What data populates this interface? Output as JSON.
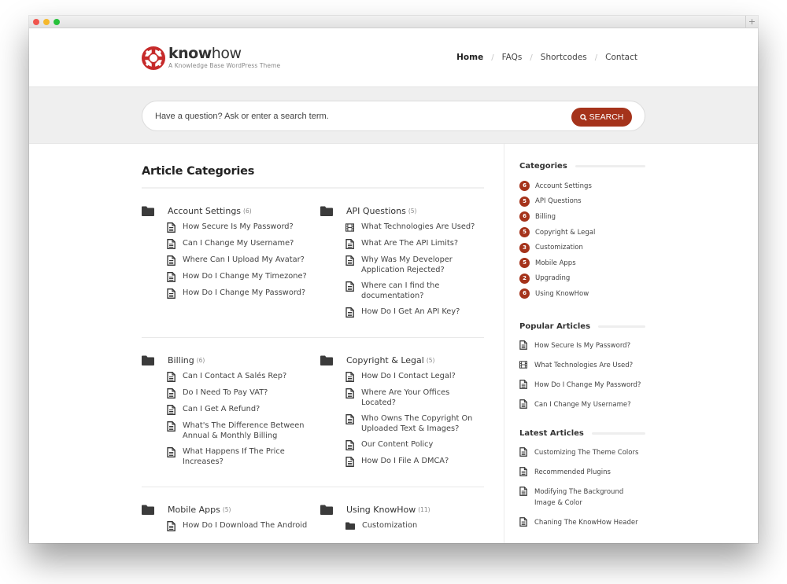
{
  "window": {
    "controls": [
      "close",
      "minimize",
      "maximize"
    ],
    "new_tab_icon": "plus-icon",
    "new_tab_label": "+"
  },
  "header": {
    "logo": {
      "icon": "lifebuoy-icon",
      "word_bold": "know",
      "word_light": "how",
      "tagline": "A Knowledge Base WordPress Theme"
    },
    "nav": [
      {
        "label": "Home",
        "active": true
      },
      {
        "label": "FAQs",
        "active": false
      },
      {
        "label": "Shortcodes",
        "active": false
      },
      {
        "label": "Contact",
        "active": false
      }
    ],
    "nav_separator": "/"
  },
  "search": {
    "placeholder": "Have a question? Ask or enter a search term.",
    "value": "",
    "button_label": "SEARCH",
    "button_icon": "search-icon"
  },
  "colors": {
    "accent": "#a5331b",
    "text": "#333333",
    "band": "#efefef"
  },
  "main": {
    "title": "Article Categories",
    "rows": [
      [
        {
          "name": "Account Settings",
          "count": "(6)",
          "articles": [
            {
              "title": "How Secure Is My Password?",
              "icon": "document-icon"
            },
            {
              "title": "Can I Change My Username?",
              "icon": "document-icon"
            },
            {
              "title": "Where Can I Upload My Avatar?",
              "icon": "document-icon"
            },
            {
              "title": "How Do I Change My Timezone?",
              "icon": "document-icon"
            },
            {
              "title": "How Do I Change My Password?",
              "icon": "document-icon"
            }
          ]
        },
        {
          "name": "API Questions",
          "count": "(5)",
          "articles": [
            {
              "title": "What Technologies Are Used?",
              "icon": "film-icon"
            },
            {
              "title": "What Are The API Limits?",
              "icon": "document-icon"
            },
            {
              "title": "Why Was My Developer Application Rejected?",
              "icon": "document-icon"
            },
            {
              "title": "Where can I find the documentation?",
              "icon": "document-icon"
            },
            {
              "title": "How Do I Get An API Key?",
              "icon": "document-icon"
            }
          ]
        }
      ],
      [
        {
          "name": "Billing",
          "count": "(6)",
          "articles": [
            {
              "title": "Can I Contact A Salés Rep?",
              "icon": "document-icon"
            },
            {
              "title": "Do I Need To Pay VAT?",
              "icon": "document-icon"
            },
            {
              "title": "Can I Get A Refund?",
              "icon": "document-icon"
            },
            {
              "title": "What's The Difference Between Annual & Monthly Billing",
              "icon": "document-icon"
            },
            {
              "title": "What Happens If The Price Increases?",
              "icon": "document-icon"
            }
          ]
        },
        {
          "name": "Copyright & Legal",
          "count": "(5)",
          "articles": [
            {
              "title": "How Do I Contact Legal?",
              "icon": "document-icon"
            },
            {
              "title": "Where Are Your Offices Located?",
              "icon": "document-icon"
            },
            {
              "title": "Who Owns The Copyright On Uploaded Text & Images?",
              "icon": "document-icon"
            },
            {
              "title": "Our Content Policy",
              "icon": "document-icon"
            },
            {
              "title": "How Do I File A DMCA?",
              "icon": "document-icon"
            }
          ]
        }
      ],
      [
        {
          "name": "Mobile Apps",
          "count": "(5)",
          "articles": [
            {
              "title": "How Do I Download The Android",
              "icon": "document-icon"
            }
          ]
        },
        {
          "name": "Using KnowHow",
          "count": "(11)",
          "articles": [
            {
              "title": "Customization",
              "icon": "folder-icon"
            }
          ]
        }
      ]
    ]
  },
  "sidebar": {
    "categories": {
      "title": "Categories",
      "items": [
        {
          "count": "6",
          "label": "Account Settings"
        },
        {
          "count": "5",
          "label": "API Questions"
        },
        {
          "count": "6",
          "label": "Billing"
        },
        {
          "count": "5",
          "label": "Copyright & Legal"
        },
        {
          "count": "3",
          "label": "Customization"
        },
        {
          "count": "5",
          "label": "Mobile Apps"
        },
        {
          "count": "2",
          "label": "Upgrading"
        },
        {
          "count": "6",
          "label": "Using KnowHow"
        }
      ]
    },
    "popular": {
      "title": "Popular Articles",
      "items": [
        {
          "title": "How Secure Is My Password?",
          "icon": "document-icon"
        },
        {
          "title": "What Technologies Are Used?",
          "icon": "film-icon"
        },
        {
          "title": "How Do I Change My Password?",
          "icon": "document-icon"
        },
        {
          "title": "Can I Change My Username?",
          "icon": "document-icon"
        }
      ]
    },
    "latest": {
      "title": "Latest Articles",
      "items": [
        {
          "title": "Customizing The Theme Colors",
          "icon": "document-icon"
        },
        {
          "title": "Recommended Plugins",
          "icon": "document-icon"
        },
        {
          "title": "Modifying The Background Image & Color",
          "icon": "document-icon"
        },
        {
          "title": "Chaning The KnowHow Header",
          "icon": "document-icon"
        }
      ]
    }
  }
}
